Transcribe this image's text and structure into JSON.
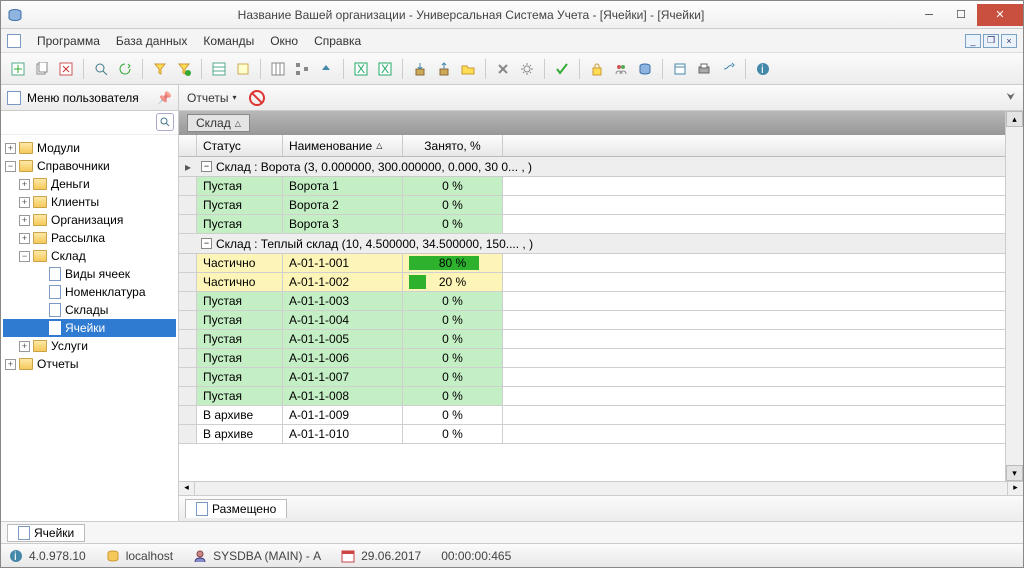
{
  "window": {
    "title": "Название Вашей организации - Универсальная Система Учета - [Ячейки] - [Ячейки]"
  },
  "menu": [
    "Программа",
    "База данных",
    "Команды",
    "Окно",
    "Справка"
  ],
  "leftpane": {
    "title": "Меню пользователя",
    "nodes": {
      "modules": "Модули",
      "refs": "Справочники",
      "money": "Деньги",
      "clients": "Клиенты",
      "org": "Организация",
      "mail": "Рассылка",
      "warehouse": "Склад",
      "celltypes": "Виды ячеек",
      "nomen": "Номенклатура",
      "whs": "Склады",
      "cells": "Ячейки",
      "services": "Услуги",
      "reports_n": "Отчеты"
    }
  },
  "rp": {
    "reports": "Отчеты"
  },
  "grid": {
    "groupfield": "Склад",
    "cols": {
      "status": "Статус",
      "name": "Наименование",
      "pct": "Занято, %"
    },
    "g1": "Склад : Ворота (3, 0.000000, 300.000000, 0.000, 30 0... , )",
    "g2": "Склад : Теплый склад (10, 4.500000, 34.500000, 150.... , )",
    "rows1": [
      {
        "status": "Пустая",
        "name": "Ворота 1",
        "pct": "0 %",
        "fill": 0
      },
      {
        "status": "Пустая",
        "name": "Ворота 2",
        "pct": "0 %",
        "fill": 0
      },
      {
        "status": "Пустая",
        "name": "Ворота 3",
        "pct": "0 %",
        "fill": 0
      }
    ],
    "rows2": [
      {
        "status": "Частично",
        "name": "А-01-1-001",
        "pct": "80 %",
        "fill": 80,
        "cls": "yellow"
      },
      {
        "status": "Частично",
        "name": "А-01-1-002",
        "pct": "20 %",
        "fill": 20,
        "cls": "yellow"
      },
      {
        "status": "Пустая",
        "name": "А-01-1-003",
        "pct": "0 %",
        "fill": 0,
        "cls": "green"
      },
      {
        "status": "Пустая",
        "name": "А-01-1-004",
        "pct": "0 %",
        "fill": 0,
        "cls": "green"
      },
      {
        "status": "Пустая",
        "name": "А-01-1-005",
        "pct": "0 %",
        "fill": 0,
        "cls": "green"
      },
      {
        "status": "Пустая",
        "name": "А-01-1-006",
        "pct": "0 %",
        "fill": 0,
        "cls": "green"
      },
      {
        "status": "Пустая",
        "name": "А-01-1-007",
        "pct": "0 %",
        "fill": 0,
        "cls": "green"
      },
      {
        "status": "Пустая",
        "name": "А-01-1-008",
        "pct": "0 %",
        "fill": 0,
        "cls": "green"
      },
      {
        "status": "В архиве",
        "name": "А-01-1-009",
        "pct": "0 %",
        "fill": 0,
        "cls": "white"
      },
      {
        "status": "В архиве",
        "name": "А-01-1-010",
        "pct": "0 %",
        "fill": 0,
        "cls": "white"
      }
    ]
  },
  "bottomtab": "Размещено",
  "wintab": "Ячейки",
  "status": {
    "ver": "4.0.978.10",
    "host": "localhost",
    "user": "SYSDBA (MAIN) - А",
    "date": "29.06.2017",
    "time": "00:00:00:465"
  }
}
